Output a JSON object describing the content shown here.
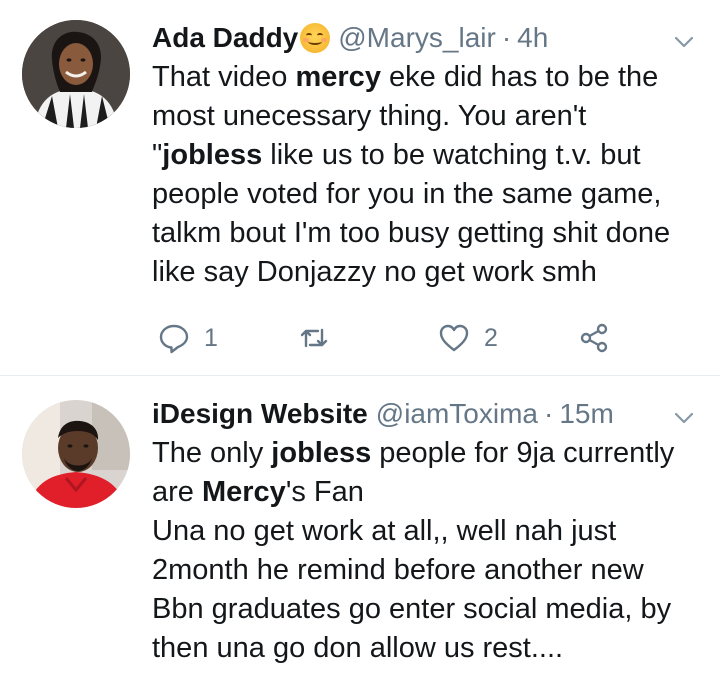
{
  "tweets": [
    {
      "name": "Ada Daddy",
      "handle": "@Marys_lair",
      "separator": "·",
      "time": "4h",
      "lines": [
        [
          {
            "t": "That video "
          },
          {
            "t": "mercy",
            "b": true
          },
          {
            "t": " eke did has to be the"
          }
        ],
        [
          {
            "t": "most unecessary thing. You aren't"
          }
        ],
        [
          {
            "t": "\""
          },
          {
            "t": "jobless",
            "b": true
          },
          {
            "t": " like us to be watching t.v. but"
          }
        ],
        [
          {
            "t": "people voted for you in the same game,"
          }
        ],
        [
          {
            "t": "talkm bout I'm too busy getting shit done"
          }
        ],
        [
          {
            "t": "like say Donjazzy no get work smh"
          }
        ]
      ],
      "reply_count": "1",
      "retweet_count": "",
      "like_count": "2"
    },
    {
      "name": "iDesign Website",
      "handle": "@iamToxima",
      "separator": "·",
      "time": "15m",
      "lines": [
        [
          {
            "t": "The only "
          },
          {
            "t": "jobless",
            "b": true
          },
          {
            "t": " people for 9ja currently"
          }
        ],
        [
          {
            "t": "are "
          },
          {
            "t": "Mercy",
            "b": true
          },
          {
            "t": "'s Fan"
          }
        ],
        [
          {
            "t": "Una no get work at all,, well nah just"
          }
        ],
        [
          {
            "t": "2month he remind before another new"
          }
        ],
        [
          {
            "t": "Bbn graduates go enter social media, by"
          }
        ],
        [
          {
            "t": "then una go don allow us rest...."
          }
        ]
      ]
    }
  ],
  "icons": {
    "reply": "reply-icon",
    "retweet": "retweet-icon",
    "like": "heart-icon",
    "share": "share-icon",
    "menu": "chevron-down-icon",
    "emoji": "smiling-face-emoji"
  },
  "colors": {
    "text": "#14171a",
    "secondary": "#657786",
    "divider": "#e6ecf0"
  }
}
